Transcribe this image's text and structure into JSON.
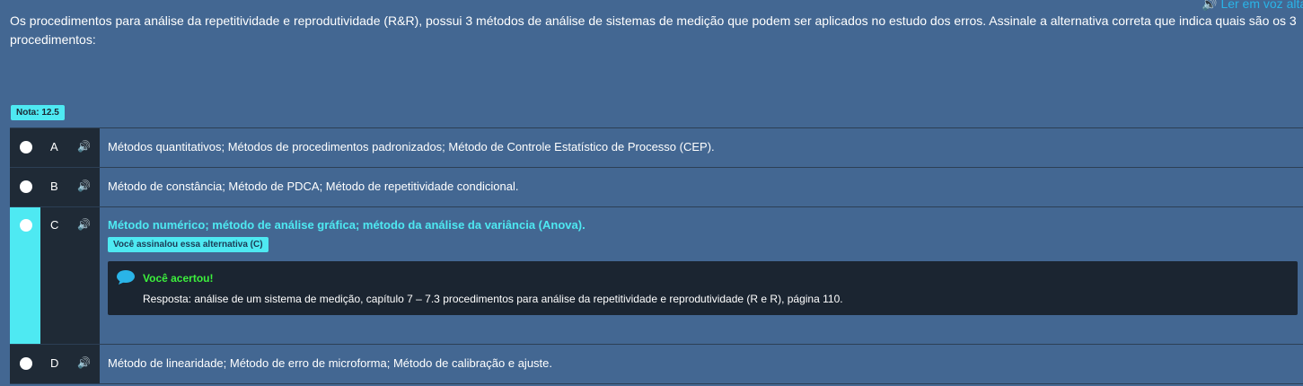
{
  "question": {
    "text": "Os procedimentos para análise da repetitividade e reprodutividade (R&R), possui 3 métodos de análise de sistemas de medição que podem ser aplicados no estudo dos erros. Assinale a alternativa correta que indica quais são os 3 procedimentos:",
    "read_aloud_label": "Ler em voz alta"
  },
  "grade": {
    "label": "Nota: 12.5"
  },
  "options": [
    {
      "letter": "A",
      "text": "Métodos quantitativos; Métodos de procedimentos padronizados; Método de Controle Estatístico de Processo (CEP)."
    },
    {
      "letter": "B",
      "text": "Método de constância; Método de PDCA; Método de repetitividade condicional."
    },
    {
      "letter": "C",
      "text": "Método numérico; método de análise gráfica; método da análise da variância (Anova).",
      "selected_badge": "Você assinalou essa alternativa (C)",
      "feedback_title": "Você acertou!",
      "feedback_text": "Resposta: análise de um sistema de medição, capítulo 7 – 7.3 procedimentos para análise da repetitividade e reprodutividade (R e R), página 110."
    },
    {
      "letter": "D",
      "text": "Método de linearidade; Método de erro de microforma; Método de calibração e ajuste."
    }
  ],
  "colors": {
    "background": "#436792",
    "accent": "#4ee9f2",
    "dark": "#1f2a36",
    "speaker": "#2ab4e8",
    "success": "#3cf03c"
  },
  "icons": {
    "speaker": "speaker-icon",
    "bubble": "speech-bubble-icon"
  }
}
